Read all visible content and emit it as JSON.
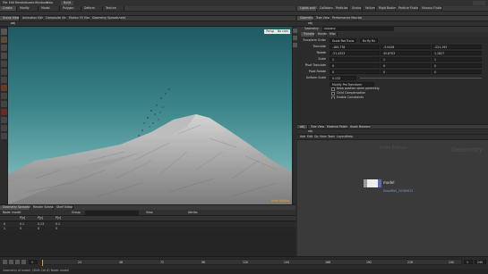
{
  "menu": [
    "File",
    "Edit",
    "Render",
    "Assets",
    "Windows",
    "Help"
  ],
  "main_toolbar": {
    "mode": "Build",
    "tabs": [
      "Create",
      "Modify",
      "Model",
      "Polygon",
      "Deform",
      "Texture",
      "Rigging",
      "Muscles",
      "Hair Utils",
      "Guide Process"
    ]
  },
  "shelf_tabs_right": [
    "Lights and C...",
    "Collisions",
    "Particles",
    "Grains",
    "Vellum",
    "Rigid Bodies",
    "Particle Fluids",
    "Viscous Fluids",
    "Oceans",
    "Pyro FX",
    "FEM",
    "Wires",
    "Crowds",
    "Drive Simulation"
  ],
  "viewport": {
    "tabs": [
      "Scene View",
      "Animation Editor",
      "Composite View",
      "Motion FX View",
      "Geometry Spreadsheet"
    ],
    "path": "obj",
    "camera": "Persp",
    "view": "No cam",
    "corner_label": "Indie Edition"
  },
  "param_panel": {
    "tabs": [
      "Geometry",
      "Tree View",
      "Performance Monitor"
    ],
    "path": "obj",
    "node_type": "Geometry",
    "node_name": "volcano",
    "sub_tabs": [
      "Transform",
      "Render",
      "Misc"
    ],
    "transform_order_label": "Transform Order",
    "transform_order": "Scale Rot Trans",
    "rotate_order": "Rx Ry Rz",
    "rows": [
      {
        "label": "Translate",
        "values": [
          "-185.778",
          "-3.0426",
          "-221.192"
        ]
      },
      {
        "label": "Rotate",
        "values": [
          "-21.4323",
          "45.8703",
          "1.1827"
        ]
      },
      {
        "label": "Scale",
        "values": [
          "1",
          "1",
          "1"
        ]
      },
      {
        "label": "Pivot Translate",
        "values": [
          "0",
          "0",
          "0"
        ]
      },
      {
        "label": "Pivot Rotate",
        "values": [
          "0",
          "0",
          "0"
        ]
      },
      {
        "label": "Uniform Scale",
        "values": [
          "0.132"
        ]
      }
    ],
    "modify_pre_transform": "Modify Pre-Transform",
    "checkboxes": [
      "Keep position when parenting",
      "Child Compensation",
      "Enable Constraints"
    ]
  },
  "network": {
    "tabs": [
      "obj",
      "Tree View",
      "Material Palette",
      "Asset Browser"
    ],
    "path": "obj",
    "menu": [
      "Add",
      "Edit",
      "Go",
      "View",
      "Tools",
      "Layout",
      "Help"
    ],
    "node_name": "model",
    "node_sub": "Geometry",
    "node_comment": "ShowMe2_20160612",
    "label": "Geometry",
    "indie": "Indie Edition"
  },
  "spreadsheet": {
    "tabs": [
      "Geometry Spreadsheet",
      "Render Scheduler",
      "Shelf Editor"
    ],
    "node": "Node: model",
    "columns": [
      "",
      "P[x]",
      "P[y]",
      "P[z]"
    ],
    "rows": [
      [
        "0",
        "0.1",
        "0.13",
        "0.1"
      ],
      [
        "1",
        "0",
        "0",
        "0"
      ]
    ],
    "group_label": "Group",
    "view_label": "View",
    "attrib_label": "Attribs"
  },
  "timeline": {
    "frame": "1",
    "start": "1",
    "end": "240",
    "ticks": [
      "24",
      "48",
      "72",
      "96",
      "120",
      "144",
      "168",
      "192",
      "216",
      "240"
    ],
    "status": "Geometry of model. (Shift-Ctrl-8) Node: model"
  },
  "colors": {
    "sky_top": "#1f5a63",
    "sky_bottom": "#8fc9c9",
    "node": "#ececec",
    "accent": "#e8a21b"
  }
}
